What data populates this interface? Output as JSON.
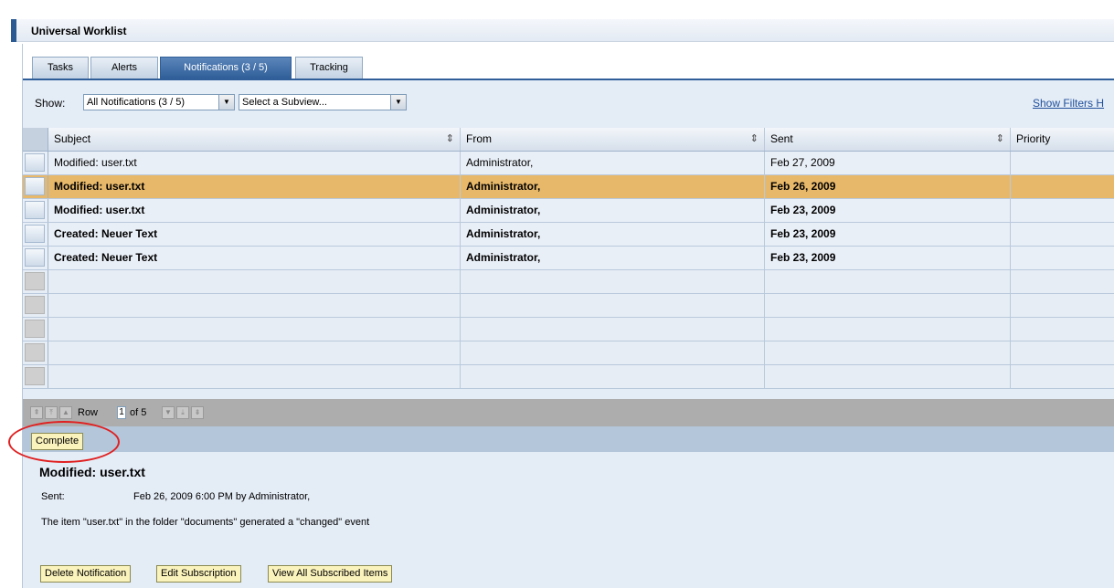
{
  "window": {
    "title": "Universal Worklist"
  },
  "tabs": [
    {
      "label": "Tasks",
      "active": false
    },
    {
      "label": "Alerts",
      "active": false
    },
    {
      "label": "Notifications (3 / 5)",
      "active": true
    },
    {
      "label": "Tracking",
      "active": false
    }
  ],
  "toolbar": {
    "show_label": "Show:",
    "view_select_value": "All Notifications  (3 / 5)",
    "subview_select_value": "Select a Subview...",
    "show_filters_label": "Show Filters",
    "show_filters_cut": "H"
  },
  "table": {
    "columns": [
      "Subject",
      "From",
      "Sent",
      "Priority"
    ],
    "rows": [
      {
        "subject": "Modified: user.txt",
        "from": "Administrator,",
        "sent": "Feb 27, 2009",
        "priority": "",
        "unread": false,
        "selected": false
      },
      {
        "subject": "Modified: user.txt",
        "from": "Administrator,",
        "sent": "Feb 26, 2009",
        "priority": "",
        "unread": true,
        "selected": true
      },
      {
        "subject": "Modified: user.txt",
        "from": "Administrator,",
        "sent": "Feb 23, 2009",
        "priority": "",
        "unread": true,
        "selected": false
      },
      {
        "subject": "Created: Neuer Text",
        "from": "Administrator,",
        "sent": "Feb 23, 2009",
        "priority": "",
        "unread": true,
        "selected": false
      },
      {
        "subject": "Created: Neuer Text",
        "from": "Administrator,",
        "sent": "Feb 23, 2009",
        "priority": "",
        "unread": true,
        "selected": false
      }
    ],
    "empty_rows": 5
  },
  "pager": {
    "row_label": "Row",
    "current_row": "1",
    "of_label": "of 5"
  },
  "actions": {
    "complete_label": "Complete"
  },
  "detail": {
    "title": "Modified: user.txt",
    "sent_label": "Sent:",
    "sent_value": "Feb 26, 2009 6:00 PM by Administrator,",
    "description": "The item \"user.txt\" in the folder \"documents\" generated a \"changed\" event",
    "buttons": {
      "delete": "Delete Notification",
      "edit": "Edit Subscription",
      "view_all": "View All Subscribed Items"
    }
  },
  "colors": {
    "accent": "#2b5a92",
    "selected_row": "#e7b86a",
    "annotation": "#e02020"
  }
}
